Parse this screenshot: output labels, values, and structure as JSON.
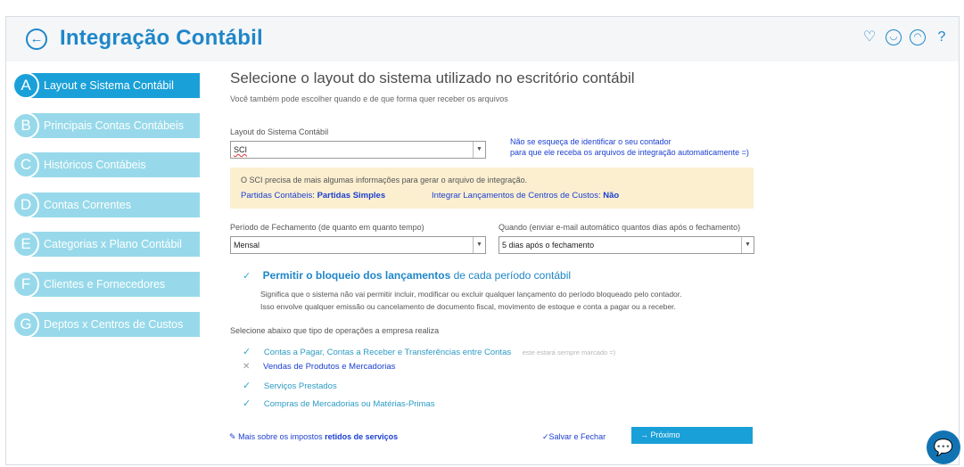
{
  "header": {
    "title": "Integração Contábil",
    "back_icon": "←",
    "icons": [
      "heart-icon",
      "smiley-icon",
      "sad-icon",
      "help-icon"
    ]
  },
  "sidebar": {
    "items": [
      {
        "letter": "A",
        "label": "Layout e Sistema Contábil",
        "active": true
      },
      {
        "letter": "B",
        "label": "Principais Contas Contábeis"
      },
      {
        "letter": "C",
        "label": "Históricos Contábeis"
      },
      {
        "letter": "D",
        "label": "Contas Correntes"
      },
      {
        "letter": "E",
        "label": "Categorias x Plano Contábil"
      },
      {
        "letter": "F",
        "label": "Clientes e Fornecedores"
      },
      {
        "letter": "G",
        "label": "Deptos x Centros de Custos"
      }
    ]
  },
  "main": {
    "heading": "Selecione o layout do sistema utilizado no escritório contábil",
    "subheading": "Você também pode escolher quando e de que forma quer receber os arquivos",
    "layout_label": "Layout do Sistema Contábil",
    "layout_value": "SCI",
    "reminder_line1": "Não se esqueça de identificar o seu contador",
    "reminder_line2": "para que ele receba os arquivos de integração automaticamente =)",
    "info_text": "O SCI precisa de mais algumas informações para gerar o arquivo de integração.",
    "partidas_label": "Partidas Contábeis:",
    "partidas_value": "Partidas Simples",
    "centros_label": "Integrar Lançamentos de Centros de Custos:",
    "centros_value": "Não",
    "periodo_label": "Período de Fechamento (de quanto em quanto tempo)",
    "periodo_value": "Mensal",
    "quando_label": "Quando (enviar e-mail automático quantos dias após o fechamento)",
    "quando_value": "5 dias após o fechamento",
    "bloqueio_bold": "Permitir o bloqueio dos lançamentos",
    "bloqueio_rest": "de cada período contábil",
    "bloqueio_desc1": "Significa que o sistema não vai permitir incluir, modificar ou excluir qualquer lançamento do período bloqueado pelo contador.",
    "bloqueio_desc2": "Isso envolve qualquer emissão ou cancelamento de documento fiscal, movimento de estoque e conta a pagar ou a receber.",
    "ops_heading": "Selecione abaixo que tipo de operações a empresa realiza",
    "operations": [
      {
        "label": "Contas a Pagar, Contas a Receber e Transferências entre Contas",
        "mark": "✓",
        "hint": "este estará sempre marcado =)"
      },
      {
        "label": "Vendas de Produtos e Mercadorias",
        "mark": "✕"
      },
      {
        "label": "Serviços Prestados",
        "mark": "✓"
      },
      {
        "label": "Compras de Mercadorias ou Matérias-Primas",
        "mark": "✓"
      }
    ]
  },
  "footer": {
    "more_text": "Mais sobre os impostos",
    "more_bold": "retidos de serviços",
    "save_label": "✓Salvar e Fechar",
    "next_label": "→  Próximo"
  },
  "colors": {
    "accent": "#1aa0d8",
    "sidebar_inactive": "#97d9ea",
    "link_blue": "#1b3fd0",
    "info_bg": "#fbefd0"
  }
}
